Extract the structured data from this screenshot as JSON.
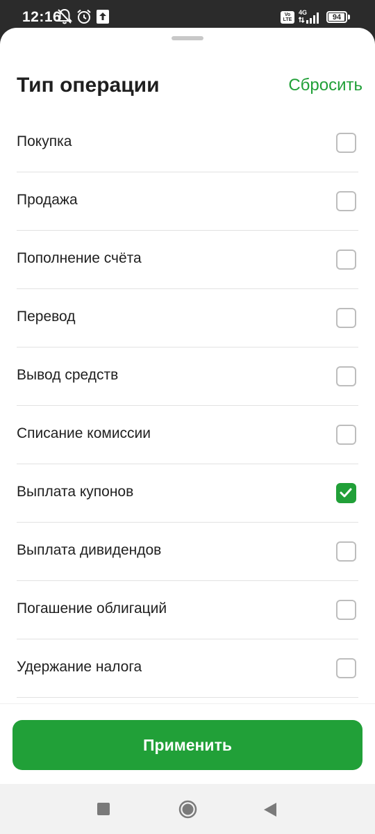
{
  "status_bar": {
    "time": "12:16",
    "icons": [
      "notifications-off-icon",
      "alarm-icon",
      "upload-icon",
      "volte-icon",
      "signal-4g-icon",
      "battery-icon"
    ],
    "network": "4G",
    "volte_line1": "Vo",
    "volte_line2": "LTE",
    "battery": "94",
    "battery_level": 0.94
  },
  "sheet": {
    "title": "Тип операции",
    "reset_label": "Сбросить",
    "accent_color": "#21a038",
    "options": [
      {
        "label": "Покупка",
        "checked": false
      },
      {
        "label": "Продажа",
        "checked": false
      },
      {
        "label": "Пополнение счёта",
        "checked": false
      },
      {
        "label": "Перевод",
        "checked": false
      },
      {
        "label": "Вывод средств",
        "checked": false
      },
      {
        "label": "Списание комиссии",
        "checked": false
      },
      {
        "label": "Выплата купонов",
        "checked": true
      },
      {
        "label": "Выплата дивидендов",
        "checked": false
      },
      {
        "label": "Погашение облигаций",
        "checked": false
      },
      {
        "label": "Удержание налога",
        "checked": false
      }
    ],
    "apply_label": "Применить"
  },
  "nav_bar": {
    "buttons": [
      "recent-apps-icon",
      "home-icon",
      "back-icon"
    ]
  }
}
